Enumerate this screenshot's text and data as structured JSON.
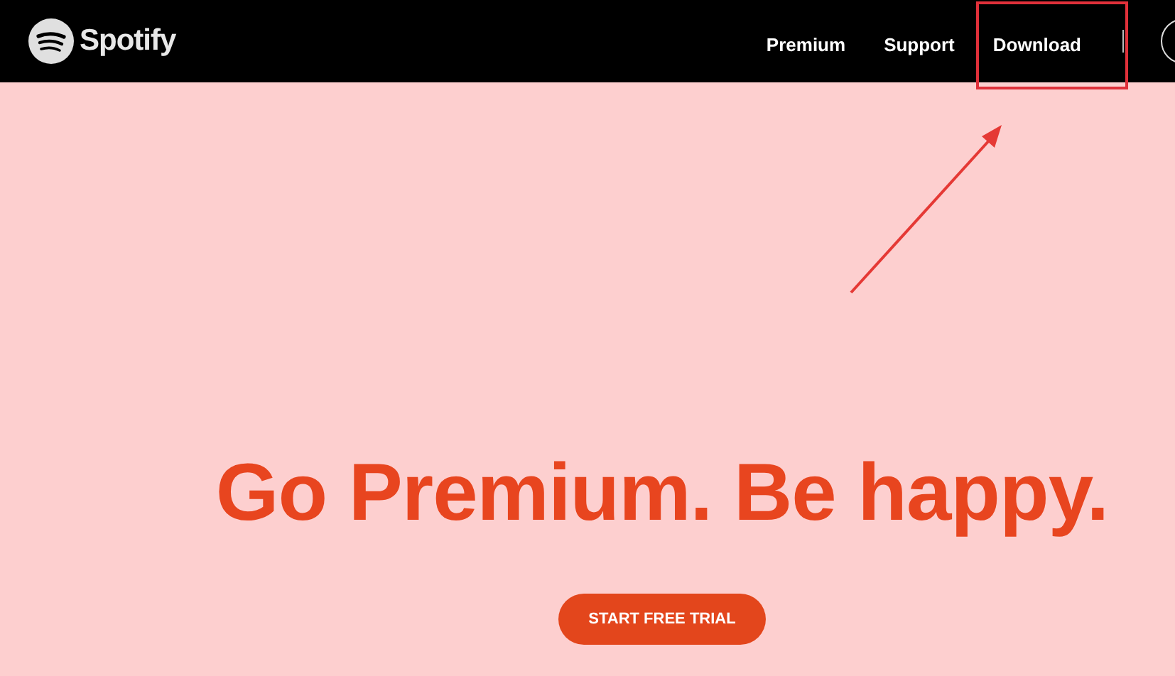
{
  "header": {
    "logo": "Spotify",
    "nav": [
      {
        "label": "Premium",
        "highlighted": false
      },
      {
        "label": "Support",
        "highlighted": false
      },
      {
        "label": "Download",
        "highlighted": true
      }
    ]
  },
  "hero": {
    "headline": "Go Premium. Be happy.",
    "button": "START FREE TRIAL"
  }
}
